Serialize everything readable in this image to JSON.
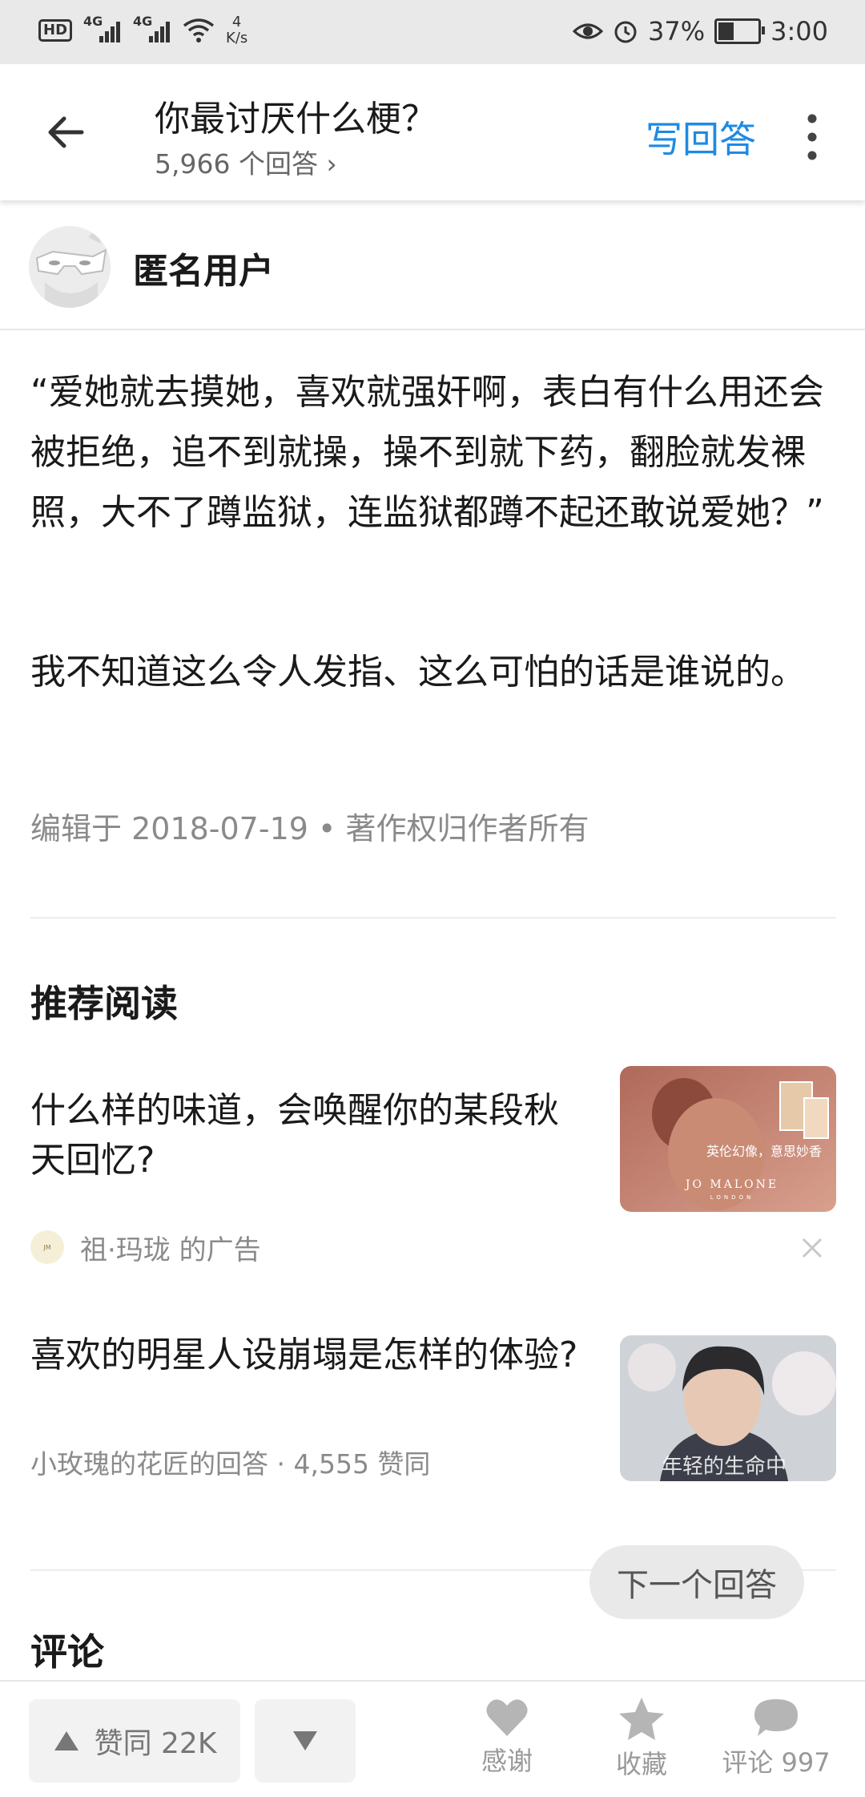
{
  "status_bar": {
    "network_1": "4G",
    "network_2": "4G",
    "speed_value": "4",
    "speed_unit": "K/s",
    "battery": "37%",
    "time": "3:00"
  },
  "header": {
    "question_title": "你最讨厌什么梗？",
    "answer_count": "5,966 个回答 ›",
    "write_answer": "写回答"
  },
  "author": {
    "name": "匿名用户"
  },
  "answer": {
    "paragraph_1": "“爱她就去摸她，喜欢就强奸啊，表白有什么用还会被拒绝，追不到就操，操不到就下药，翻脸就发裸照，大不了蹲监狱，连监狱都蹲不起还敢说爱她？”",
    "paragraph_2": "我不知道这么令人发指、这么可怕的话是谁说的。",
    "meta": "编辑于 2018-07-19 • 著作权归作者所有"
  },
  "recommended": {
    "section_title": "推荐阅读",
    "items": [
      {
        "title": "什么样的味道，会唤醒你的某段秋天回忆?",
        "ad_text": "祖·玛珑 的广告",
        "thumb_caption": "英伦幻像，意思妙香",
        "thumb_brand": "JO MALONE",
        "thumb_brand_sub": "LONDON"
      },
      {
        "title": "喜欢的明星人设崩塌是怎样的体验?",
        "meta": "小玫瑰的花匠的回答 · 4,555 赞同",
        "thumb_caption": "年轻的生命中"
      }
    ]
  },
  "next_answer": "下一个回答",
  "comments": {
    "section_title": "评论"
  },
  "bottom_bar": {
    "upvote": "赞同 22K",
    "thanks": "感谢",
    "collect": "收藏",
    "comment": "评论 997"
  },
  "colors": {
    "accent": "#1e8ae6",
    "muted": "#8a8a8a"
  }
}
